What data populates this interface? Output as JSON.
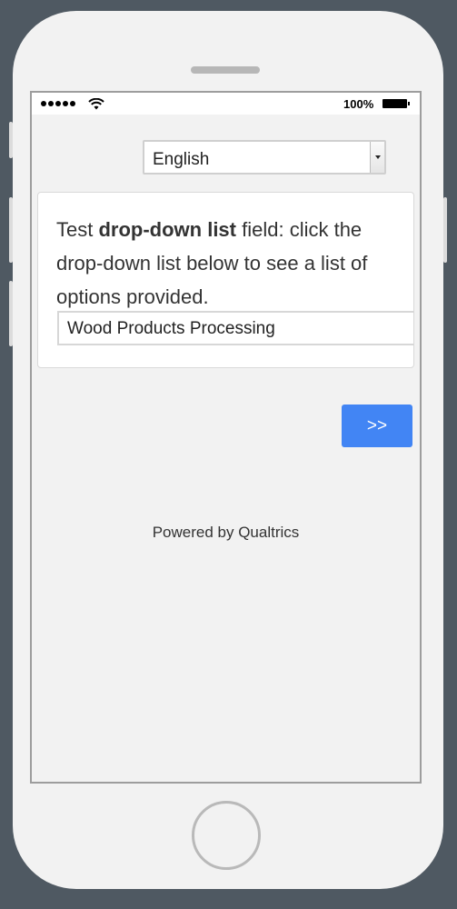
{
  "status_bar": {
    "battery_percent": "100%",
    "signal_bars": 5,
    "wifi_icon": "wifi-icon",
    "battery_icon": "battery-icon"
  },
  "language_select": {
    "selected": "English"
  },
  "question": {
    "prefix": "Test ",
    "bold": "drop-down list",
    "suffix": " field: click the drop-down list below to see a list of options provided.",
    "selected_answer": "Wood Products Processing"
  },
  "next_button": {
    "label": ">>",
    "color": "#4285f4"
  },
  "footer": {
    "powered_by": "Powered by Qualtrics"
  }
}
